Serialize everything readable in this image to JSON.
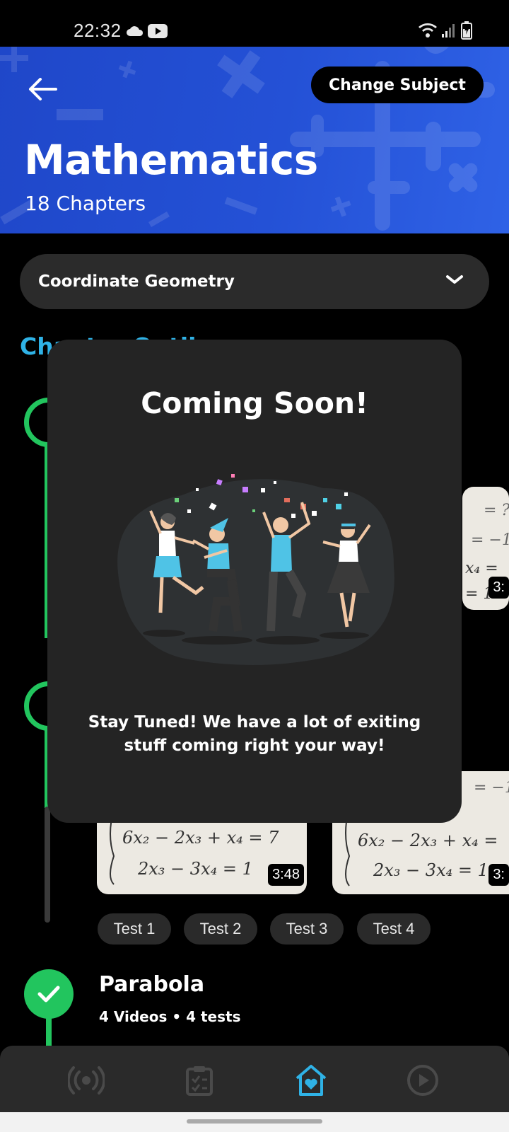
{
  "status_bar": {
    "time": "22:32",
    "icons": [
      "cloud-icon",
      "youtube-icon",
      "wifi-icon",
      "signal-icon",
      "battery-icon"
    ]
  },
  "header": {
    "back_icon": "arrow-left-icon",
    "change_subject_label": "Change Subject",
    "subject_title": "Mathematics",
    "chapter_count": "18 Chapters",
    "background_color": "#2451d6"
  },
  "chapter_select": {
    "selected": "Coordinate Geometry",
    "icon": "chevron-down-icon"
  },
  "section_heading": "Chapter Outline",
  "thumbnails": [
    {
      "duration": "3:48"
    },
    {
      "duration": "3:"
    },
    {
      "duration": "3:"
    }
  ],
  "tests": [
    "Test 1",
    "Test 2",
    "Test 3",
    "Test 4"
  ],
  "chapter": {
    "name": "Parabola",
    "meta": "4 Videos • 4 tests",
    "status_icon": "checkmark-icon"
  },
  "modal": {
    "title": "Coming Soon!",
    "message": "Stay Tuned! We have a lot of exiting stuff coming right your way!",
    "illustration": "celebration-illustration"
  },
  "bottom_nav": {
    "items": [
      {
        "name": "live-icon",
        "active": false
      },
      {
        "name": "tests-clipboard-icon",
        "active": false
      },
      {
        "name": "home-icon",
        "active": true
      },
      {
        "name": "play-icon",
        "active": false
      }
    ],
    "active_color": "#2fb2e6",
    "inactive_color": "#4a4a4a"
  },
  "colors": {
    "accent_green": "#22c55e",
    "accent_blue": "#2fb2e6"
  }
}
